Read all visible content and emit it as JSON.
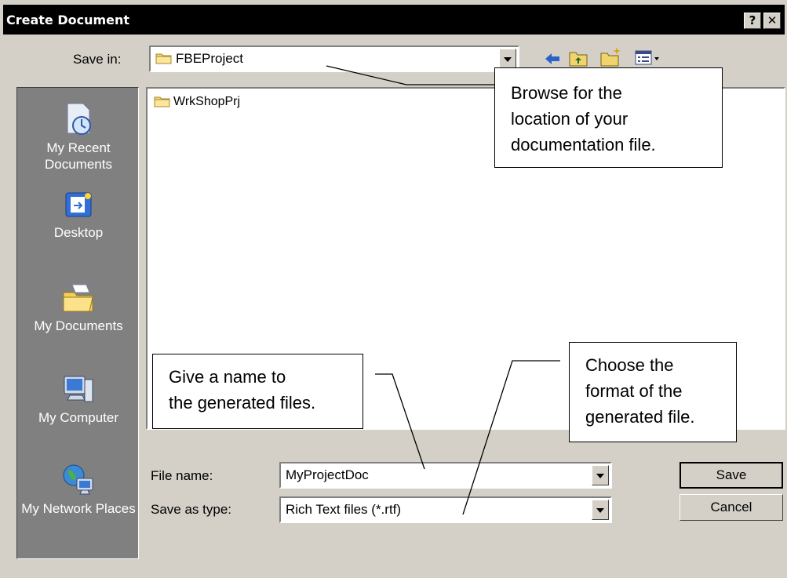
{
  "window": {
    "title": "Create Document",
    "help_label": "?",
    "close_label": "✕"
  },
  "save_in": {
    "label": "Save in:",
    "value": "FBEProject"
  },
  "toolbar": {
    "icons": [
      "back-icon",
      "up-folder-icon",
      "new-folder-icon",
      "view-menu-icon"
    ]
  },
  "places": [
    {
      "label": "My Recent Documents",
      "icon": "recent-documents-icon"
    },
    {
      "label": "Desktop",
      "icon": "desktop-icon"
    },
    {
      "label": "My Documents",
      "icon": "my-documents-icon"
    },
    {
      "label": "My Computer",
      "icon": "my-computer-icon"
    },
    {
      "label": "My Network Places",
      "icon": "network-places-icon"
    }
  ],
  "files": [
    {
      "name": "WrkShopPrj",
      "icon": "folder-icon"
    }
  ],
  "file_name": {
    "label": "File name:",
    "value": "MyProjectDoc"
  },
  "save_type": {
    "label": "Save as type:",
    "value": "Rich Text files (*.rtf)"
  },
  "buttons": {
    "save": "Save",
    "cancel": "Cancel"
  },
  "callouts": {
    "browse": [
      "Browse for the",
      "location of your",
      "documentation file."
    ],
    "name": [
      "Give a name to",
      "the generated files."
    ],
    "format": [
      "Choose the",
      "format of the",
      "generated file."
    ]
  },
  "colors": {
    "dialog_bg": "#d4d0c8",
    "title_bar": "#000000",
    "places_bar": "#808080"
  }
}
